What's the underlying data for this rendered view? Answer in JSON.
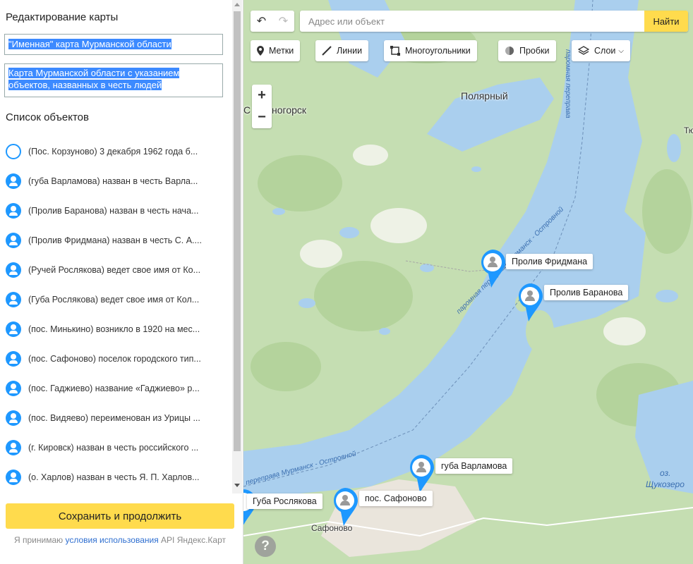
{
  "sidebar": {
    "edit_title": "Редактирование карты",
    "map_name": "\"Именная\" карта Мурманской области",
    "map_description": "Карта Мурманской области с указанием объектов, названных в честь людей",
    "list_title": "Список объектов",
    "objects": [
      {
        "icon": "circle-outline-icon",
        "text": "(Пос. Корзуново) 3 декабря 1962 года б..."
      },
      {
        "icon": "person-icon",
        "text": "(губа Варламова) назван в честь Варла..."
      },
      {
        "icon": "person-icon",
        "text": "(Пролив Баранова) назван в честь нача..."
      },
      {
        "icon": "person-icon",
        "text": "(Пролив Фридмана) назван в честь С. А...."
      },
      {
        "icon": "person-icon",
        "text": "(Ручей Рослякова) ведет свое имя от Ко..."
      },
      {
        "icon": "person-icon",
        "text": "(Губа Рослякова) ведет свое имя от Кол..."
      },
      {
        "icon": "person-icon",
        "text": "(пос. Минькино) возникло в 1920 на мес..."
      },
      {
        "icon": "person-icon",
        "text": "(пос. Сафоново) поселок городского тип..."
      },
      {
        "icon": "person-icon",
        "text": "(пос. Гаджиево) название «Гаджиево» р..."
      },
      {
        "icon": "person-icon",
        "text": "(пос. Видяево) переименован из Урицы ..."
      },
      {
        "icon": "person-icon",
        "text": "(г. Кировск) назван в честь российского ..."
      },
      {
        "icon": "person-icon",
        "text": "(о. Харлов) назван в честь Я. П. Харлов..."
      }
    ],
    "save_label": "Сохранить и продолжить",
    "terms_prefix": "Я принимаю ",
    "terms_link": "условия использования",
    "terms_suffix": " API Яндекс.Карт"
  },
  "map": {
    "search_placeholder": "Адрес или объект",
    "search_button": "Найти",
    "tools": {
      "marks": "Метки",
      "lines": "Линии",
      "polygons": "Многоугольники",
      "traffic": "Пробки",
      "layers": "Слои"
    },
    "labels": {
      "polyarny": "Полярный",
      "snezhnogorsk": "ногорск",
      "snezhnogorsk_prefix": "С",
      "edge_right": "Тю",
      "safonovo_town": "Сафоново",
      "lake_prefix": "оз.",
      "lake_name": "Щукозеро",
      "ferry_upper": "паромная переправа Мурманск - Островной",
      "ferry_lower": "переправа Мурманск - Островной",
      "ferry_top": "паромная переправа"
    },
    "placemarks": {
      "fridman": "Пролив Фридмана",
      "baranov": "Пролив Баранова",
      "varlamov": "губа Варламова",
      "roslyakov": "Губа Рослякова",
      "safonovo": "пос. Сафоново"
    },
    "colors": {
      "water": "#aacfee",
      "land": "#c5deb2",
      "accent": "#1e98ff",
      "button_yellow": "#ffdb4d"
    }
  }
}
